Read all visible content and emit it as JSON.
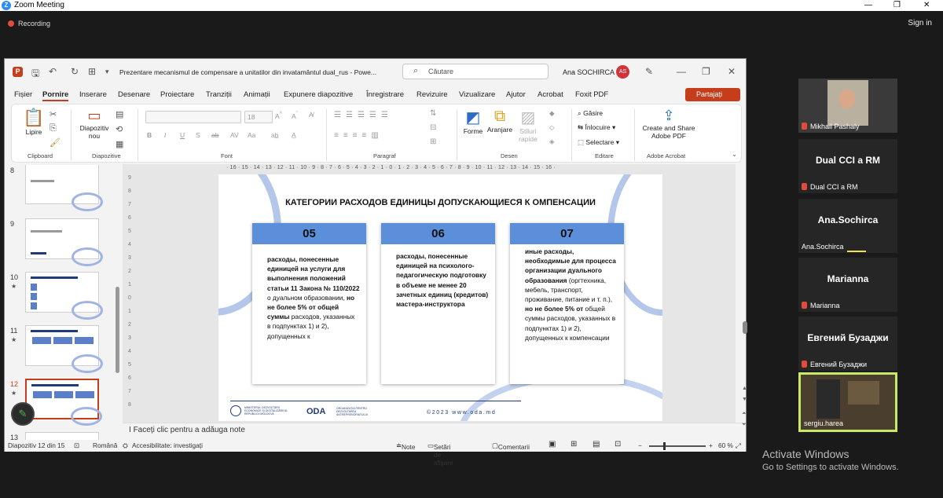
{
  "zoom": {
    "window_title": "Zoom Meeting",
    "recording_label": "Recording",
    "sign_in": "Sign in",
    "window_controls": [
      "—",
      "❐",
      "✕"
    ]
  },
  "powerpoint": {
    "doc_title": "Prezentare mecanismul de compensare a unitatilor din invatamântul dual_rus  -  Powe...",
    "search_placeholder": "Căutare",
    "user_name": "Ana SOCHIRCA",
    "user_initials": "AS",
    "share_label": "Partajați",
    "menu_tabs": [
      "Fișier",
      "Pornire",
      "Inserare",
      "Desenare",
      "Proiectare",
      "Tranziții",
      "Animații",
      "Expunere diapozitive",
      "Înregistrare",
      "Revizuire",
      "Vizualizare",
      "Ajutor",
      "Acrobat",
      "Foxit PDF"
    ],
    "ribbon": {
      "paste": "Lipire",
      "clipboard": "Clipboard",
      "new_slide_1": "Diapozitiv",
      "new_slide_2": "nou",
      "slides": "Diapozitive",
      "font_size": "18",
      "font": "Font",
      "bold": "B",
      "italic": "I",
      "underline": "U",
      "strike": "S",
      "paragraph": "Paragraf",
      "shapes": "Forme",
      "arrange": "Aranjare",
      "styles_1": "Stiluri",
      "styles_2": "rapide",
      "drawing": "Desen",
      "find": "Găsire",
      "replace": "Înlocuire",
      "select": "Selectare",
      "editing": "Editare",
      "create_share_1": "Create and Share",
      "create_share_2": "Adobe PDF",
      "adobe": "Adobe Acrobat"
    },
    "thumbnails": [
      {
        "num": "8",
        "star": ""
      },
      {
        "num": "9",
        "star": ""
      },
      {
        "num": "10",
        "star": "★"
      },
      {
        "num": "11",
        "star": "★"
      },
      {
        "num": "12",
        "star": "★"
      },
      {
        "num": "13",
        "star": ""
      }
    ],
    "ruler_h": "· 16 · 15 · 14 · 13 · 12 · 11 · 10 · 9 · 8 · 7 · 6 · 5 · 4 · 3 · 2 · 1 · 0 · 1 · 2 · 3 · 4 · 5 · 6 · 7 · 8 · 9 · 10 · 11 · 12 · 13 · 14 · 15 · 16 ·",
    "ruler_v": [
      "9",
      "8",
      "7",
      "6",
      "5",
      "4",
      "3",
      "2",
      "1",
      "0",
      "1",
      "2",
      "3",
      "4",
      "5",
      "6",
      "7",
      "8"
    ],
    "slide": {
      "title": "КАТЕГОРИИ РАСХОДОВ ЕДИНИЦЫ ДОПУСКАЮЩИЕСЯ К ОМПЕНСАЦИИ",
      "cards": [
        {
          "number": "05",
          "p1": "расходы, понесенные единицей на услуги для выполнения положений статьи 11 Закона № 110/2022",
          "p2": " о дуальном образовании, ",
          "p3": "но не более 5% от общей суммы",
          "p4": " расходов, указанных в подпунктах 1) и 2), допущенных к"
        },
        {
          "number": "06",
          "p1": "расходы, понесенные единицей на психолого-педагогическую подготовку в объеме не менее 20 зачетных единиц (кредитов) мастера-инструктора",
          "p2": "",
          "p3": "",
          "p4": ""
        },
        {
          "number": "07",
          "p1": "иные расходы, необходимые для процесса организации дуального образования",
          "p2": " (оргтехника, мебель, транспорт, проживание, питание и т. п.), ",
          "p3": "но не более 5% от",
          "p4": " общей суммы расходов, указанных в подпунктах 1) и 2), допущенных к компенсации"
        }
      ],
      "footer_org": "MINISTERUL DEZVOLTĂRII ECONOMICE ȘI DIGITALIZĂRII AL REPUBLICII MOLDOVA",
      "footer_oda": "ODA",
      "footer_oda_sub": "ORGANIZAȚIA PENTRU DEZVOLTAREA ANTREPRENORIATULUI",
      "footer_web": "©2023   www.oda.md"
    },
    "notes_placeholder": "Faceți clic pentru a adăuga note",
    "status": {
      "slide_counter": "Diapozitiv 12 din 15",
      "language": "Română",
      "accessibility": "Accesibilitate: investigați",
      "notes": "Note",
      "display_settings": "Setări de afișare",
      "comments": "Comentarii",
      "zoom": "60 %"
    }
  },
  "participants": [
    {
      "display": "",
      "name": "Mikhail Pashaly",
      "muted": true,
      "video": true
    },
    {
      "display": "Dual CCI a RM",
      "name": "Dual CCI a RM",
      "muted": true,
      "video": false
    },
    {
      "display": "Ana.Sochirca",
      "name": "Ana.Sochirca",
      "muted": false,
      "video": false
    },
    {
      "display": "Marianna",
      "name": "Marianna",
      "muted": true,
      "video": false
    },
    {
      "display": "Евгений Бузаджи",
      "name": "Евгений Бузаджи",
      "muted": true,
      "video": false
    },
    {
      "display": "",
      "name": "sergiu.harea",
      "muted": false,
      "video": true
    }
  ],
  "activate": {
    "title": "Activate Windows",
    "subtitle": "Go to Settings to activate Windows."
  },
  "colors": {
    "ppt_accent": "#c43e1c",
    "slide_header": "#5b8fd9",
    "zoom_blue": "#2d8cff"
  }
}
